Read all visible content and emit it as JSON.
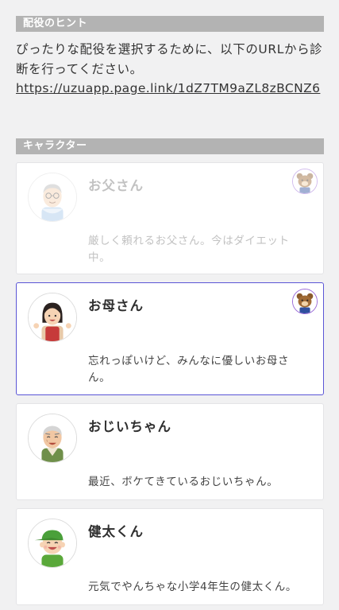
{
  "hint": {
    "header": "配役のヒント",
    "body": "ぴったりな配役を選択するために、以下のURLから診断を行ってください。",
    "link": "https://uzuapp.page.link/1dZ7TM9aZL8zBCNZ6"
  },
  "characters": {
    "header": "キャラクター",
    "items": [
      {
        "name": "お父さん",
        "description": "厳しく頼れるお父さん。今はダイエット中。",
        "avatar_icon": "father-avatar-icon",
        "badge_icon": "bear-badge-icon",
        "state": "taken"
      },
      {
        "name": "お母さん",
        "description": "忘れっぽいけど、みんなに優しいお母さん。",
        "avatar_icon": "mother-avatar-icon",
        "badge_icon": "bear-badge-icon",
        "state": "selected"
      },
      {
        "name": "おじいちゃん",
        "description": "最近、ボケてきているおじいちゃん。",
        "avatar_icon": "grandfather-avatar-icon",
        "state": "available"
      },
      {
        "name": "健太くん",
        "description": "元気でやんちゃな小学4年生の健太くん。",
        "avatar_icon": "boy-avatar-icon",
        "state": "available"
      }
    ]
  },
  "colors": {
    "selected_border": "#5a55d6",
    "section_header_bg": "#b3b3b3",
    "badge_border": "#9a6bd8"
  }
}
